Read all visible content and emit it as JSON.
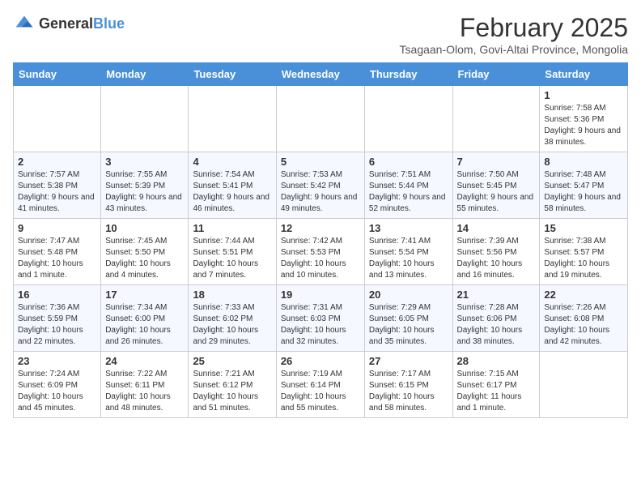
{
  "logo": {
    "general": "General",
    "blue": "Blue"
  },
  "header": {
    "month": "February 2025",
    "subtitle": "Tsagaan-Olom, Govi-Altai Province, Mongolia"
  },
  "days_of_week": [
    "Sunday",
    "Monday",
    "Tuesday",
    "Wednesday",
    "Thursday",
    "Friday",
    "Saturday"
  ],
  "weeks": [
    [
      {
        "day": "",
        "info": ""
      },
      {
        "day": "",
        "info": ""
      },
      {
        "day": "",
        "info": ""
      },
      {
        "day": "",
        "info": ""
      },
      {
        "day": "",
        "info": ""
      },
      {
        "day": "",
        "info": ""
      },
      {
        "day": "1",
        "info": "Sunrise: 7:58 AM\nSunset: 5:36 PM\nDaylight: 9 hours and 38 minutes."
      }
    ],
    [
      {
        "day": "2",
        "info": "Sunrise: 7:57 AM\nSunset: 5:38 PM\nDaylight: 9 hours and 41 minutes."
      },
      {
        "day": "3",
        "info": "Sunrise: 7:55 AM\nSunset: 5:39 PM\nDaylight: 9 hours and 43 minutes."
      },
      {
        "day": "4",
        "info": "Sunrise: 7:54 AM\nSunset: 5:41 PM\nDaylight: 9 hours and 46 minutes."
      },
      {
        "day": "5",
        "info": "Sunrise: 7:53 AM\nSunset: 5:42 PM\nDaylight: 9 hours and 49 minutes."
      },
      {
        "day": "6",
        "info": "Sunrise: 7:51 AM\nSunset: 5:44 PM\nDaylight: 9 hours and 52 minutes."
      },
      {
        "day": "7",
        "info": "Sunrise: 7:50 AM\nSunset: 5:45 PM\nDaylight: 9 hours and 55 minutes."
      },
      {
        "day": "8",
        "info": "Sunrise: 7:48 AM\nSunset: 5:47 PM\nDaylight: 9 hours and 58 minutes."
      }
    ],
    [
      {
        "day": "9",
        "info": "Sunrise: 7:47 AM\nSunset: 5:48 PM\nDaylight: 10 hours and 1 minute."
      },
      {
        "day": "10",
        "info": "Sunrise: 7:45 AM\nSunset: 5:50 PM\nDaylight: 10 hours and 4 minutes."
      },
      {
        "day": "11",
        "info": "Sunrise: 7:44 AM\nSunset: 5:51 PM\nDaylight: 10 hours and 7 minutes."
      },
      {
        "day": "12",
        "info": "Sunrise: 7:42 AM\nSunset: 5:53 PM\nDaylight: 10 hours and 10 minutes."
      },
      {
        "day": "13",
        "info": "Sunrise: 7:41 AM\nSunset: 5:54 PM\nDaylight: 10 hours and 13 minutes."
      },
      {
        "day": "14",
        "info": "Sunrise: 7:39 AM\nSunset: 5:56 PM\nDaylight: 10 hours and 16 minutes."
      },
      {
        "day": "15",
        "info": "Sunrise: 7:38 AM\nSunset: 5:57 PM\nDaylight: 10 hours and 19 minutes."
      }
    ],
    [
      {
        "day": "16",
        "info": "Sunrise: 7:36 AM\nSunset: 5:59 PM\nDaylight: 10 hours and 22 minutes."
      },
      {
        "day": "17",
        "info": "Sunrise: 7:34 AM\nSunset: 6:00 PM\nDaylight: 10 hours and 26 minutes."
      },
      {
        "day": "18",
        "info": "Sunrise: 7:33 AM\nSunset: 6:02 PM\nDaylight: 10 hours and 29 minutes."
      },
      {
        "day": "19",
        "info": "Sunrise: 7:31 AM\nSunset: 6:03 PM\nDaylight: 10 hours and 32 minutes."
      },
      {
        "day": "20",
        "info": "Sunrise: 7:29 AM\nSunset: 6:05 PM\nDaylight: 10 hours and 35 minutes."
      },
      {
        "day": "21",
        "info": "Sunrise: 7:28 AM\nSunset: 6:06 PM\nDaylight: 10 hours and 38 minutes."
      },
      {
        "day": "22",
        "info": "Sunrise: 7:26 AM\nSunset: 6:08 PM\nDaylight: 10 hours and 42 minutes."
      }
    ],
    [
      {
        "day": "23",
        "info": "Sunrise: 7:24 AM\nSunset: 6:09 PM\nDaylight: 10 hours and 45 minutes."
      },
      {
        "day": "24",
        "info": "Sunrise: 7:22 AM\nSunset: 6:11 PM\nDaylight: 10 hours and 48 minutes."
      },
      {
        "day": "25",
        "info": "Sunrise: 7:21 AM\nSunset: 6:12 PM\nDaylight: 10 hours and 51 minutes."
      },
      {
        "day": "26",
        "info": "Sunrise: 7:19 AM\nSunset: 6:14 PM\nDaylight: 10 hours and 55 minutes."
      },
      {
        "day": "27",
        "info": "Sunrise: 7:17 AM\nSunset: 6:15 PM\nDaylight: 10 hours and 58 minutes."
      },
      {
        "day": "28",
        "info": "Sunrise: 7:15 AM\nSunset: 6:17 PM\nDaylight: 11 hours and 1 minute."
      },
      {
        "day": "",
        "info": ""
      }
    ]
  ]
}
